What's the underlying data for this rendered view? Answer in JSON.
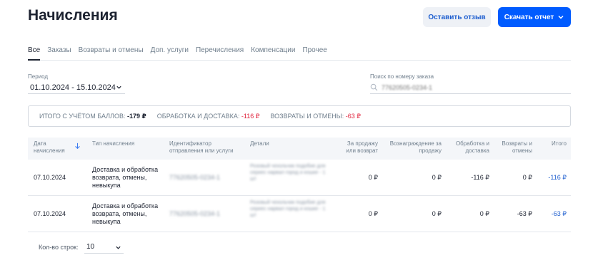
{
  "page": {
    "title": "Начисления"
  },
  "header": {
    "feedback_label": "Оставить отзыв",
    "report_label": "Скачать отчет"
  },
  "tabs": [
    "Все",
    "Заказы",
    "Возвраты и отмены",
    "Доп. услуги",
    "Перечисления",
    "Компенсации",
    "Прочее"
  ],
  "filters": {
    "period_label": "Период",
    "period_value": "01.10.2024 - 15.10.2024",
    "search_label": "Поиск по номеру заказа",
    "search_placeholder": "77620505-0234-1"
  },
  "summary": {
    "total_label": "ИТОГО С УЧЁТОМ БАЛЛОВ:",
    "total_value": "-179 ₽",
    "processing_label": "ОБРАБОТКА И ДОСТАВКА:",
    "processing_value": "-116 ₽",
    "returns_label": "ВОЗВРАТЫ И ОТМЕНЫ:",
    "returns_value": "-63 ₽"
  },
  "table": {
    "headers": {
      "date": "Дата\nначисления",
      "type": "Тип начисления",
      "id": "Идентификатор\nотправления или услуги",
      "details": "Детали",
      "sale": "За продажу\nили возврат",
      "reward": "Вознаграждение за\nпродажу",
      "processing": "Обработка и\nдоставка",
      "returns": "Возвраты и\nотмены",
      "total": "Итого"
    },
    "rows": [
      {
        "date": "07.10.2024",
        "type": "Доставка и обработка возврата, отмены, невыкупа",
        "id": "77620505-0234-1",
        "details": "Розовый чехольчик подобие для сериес нарвал город и кошке - 1 шт",
        "sale": "0 ₽",
        "reward": "0 ₽",
        "processing": "-116 ₽",
        "returns": "0 ₽",
        "total": "-116 ₽"
      },
      {
        "date": "07.10.2024",
        "type": "Доставка и обработка возврата, отмены, невыкупа",
        "id": "77620505-0234-1",
        "details": "Розовый чехольчик подобие для сериес нарвал город и кошке - 1 шт",
        "sale": "0 ₽",
        "reward": "0 ₽",
        "processing": "0 ₽",
        "returns": "-63 ₽",
        "total": "-63 ₽"
      }
    ]
  },
  "pagination": {
    "rows_label": "Кол-во строк:",
    "rows_value": "10"
  }
}
